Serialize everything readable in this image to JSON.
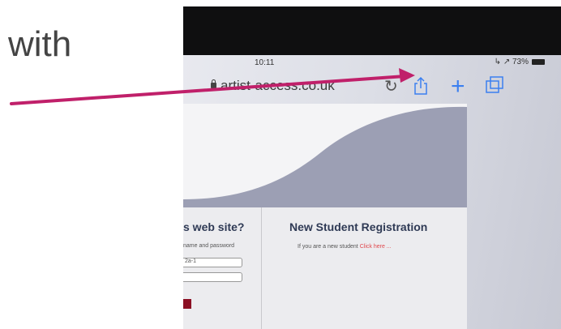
{
  "slide": {
    "text": "with"
  },
  "status_bar": {
    "time": "10:11",
    "signal": "↳ ↗ 73%"
  },
  "browser": {
    "url": "artist-access.co.uk"
  },
  "page": {
    "login_title": "s web site?",
    "login_hint": "name and password",
    "field_1_value": "2a-1",
    "registration_title": "New Student Registration",
    "registration_text": "If you are a new student",
    "registration_link": "Click here ..."
  },
  "colors": {
    "arrow": "#c0206a",
    "toolbar_blue": "#3b7ff0",
    "login_button": "#8b0f24",
    "link_red": "#e0474c"
  },
  "icons": [
    "lock-icon",
    "reload-icon",
    "share-icon",
    "plus-icon",
    "tabs-icon",
    "battery-icon"
  ]
}
